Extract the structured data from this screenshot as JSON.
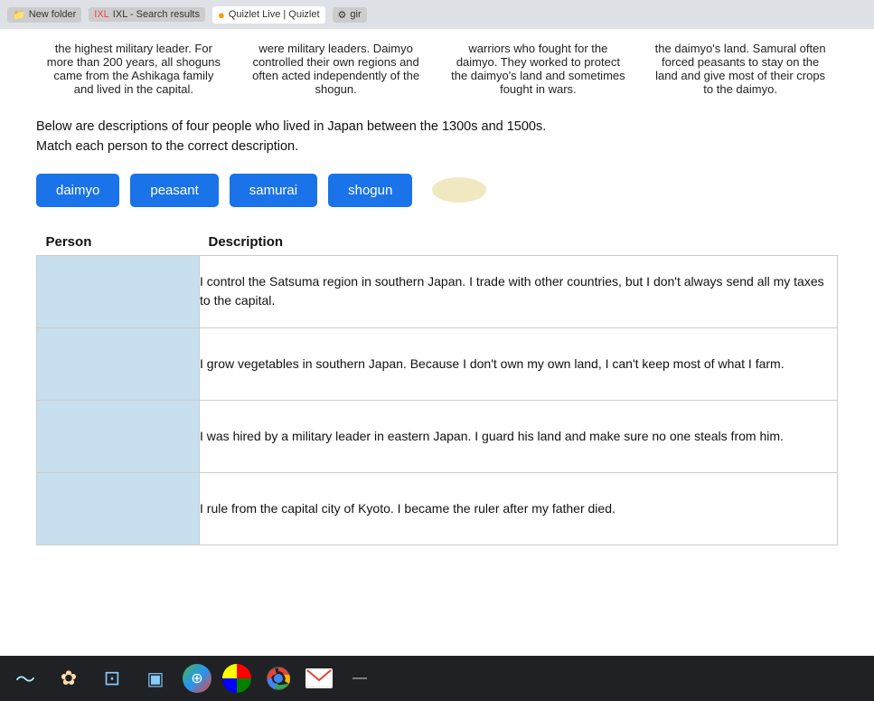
{
  "browser": {
    "tabs": [
      {
        "label": "New folder",
        "icon": "folder"
      },
      {
        "label": "IXL - Search results",
        "icon": "ixl"
      },
      {
        "label": "Quizlet Live | Quizlet",
        "icon": "quizlet",
        "active": true
      },
      {
        "label": "gir",
        "icon": "gir"
      }
    ]
  },
  "info_columns": [
    {
      "text": "the highest military leader. For more than 200 years, all shoguns came from the Ashikaga family and lived in the capital."
    },
    {
      "text": "were military leaders. Daimyo controlled their own regions and often acted independently of the shogun."
    },
    {
      "text": "warriors who fought for the daimyo. They worked to protect the daimyo's land and sometimes fought in wars."
    },
    {
      "text": "the daimyo's land. Samural often forced peasants to stay on the land and give most of their crops to the daimyo."
    }
  ],
  "instruction": {
    "line1": "Below are descriptions of four people who lived in Japan between the 1300s and 1500s.",
    "line2": "Match each person to the correct description."
  },
  "answer_buttons": [
    {
      "label": "daimyo",
      "id": "daimyo"
    },
    {
      "label": "peasant",
      "id": "peasant"
    },
    {
      "label": "samurai",
      "id": "samurai"
    },
    {
      "label": "shogun",
      "id": "shogun"
    }
  ],
  "table": {
    "headers": {
      "person": "Person",
      "description": "Description"
    },
    "rows": [
      {
        "description": "I control the Satsuma region in southern Japan. I trade with other countries, but I don't always send all my taxes to the capital."
      },
      {
        "description": "I grow vegetables in southern Japan. Because I don't own my own land, I can't keep most of what I farm."
      },
      {
        "description": "I was hired by a military leader in eastern Japan. I guard his land and make sure no one steals from him."
      },
      {
        "description": "I rule from the capital city of Kyoto. I became the ruler after my father died."
      }
    ]
  },
  "taskbar_icons": [
    {
      "name": "wave",
      "symbol": "〜"
    },
    {
      "name": "settings",
      "symbol": "✿"
    },
    {
      "name": "files",
      "symbol": "⊡"
    },
    {
      "name": "monitor",
      "symbol": "▣"
    },
    {
      "name": "globe",
      "symbol": "⊕"
    },
    {
      "name": "circle",
      "symbol": "●"
    },
    {
      "name": "chrome",
      "symbol": "◎"
    },
    {
      "name": "mail",
      "symbol": "M"
    },
    {
      "name": "minimize",
      "symbol": "—"
    }
  ]
}
